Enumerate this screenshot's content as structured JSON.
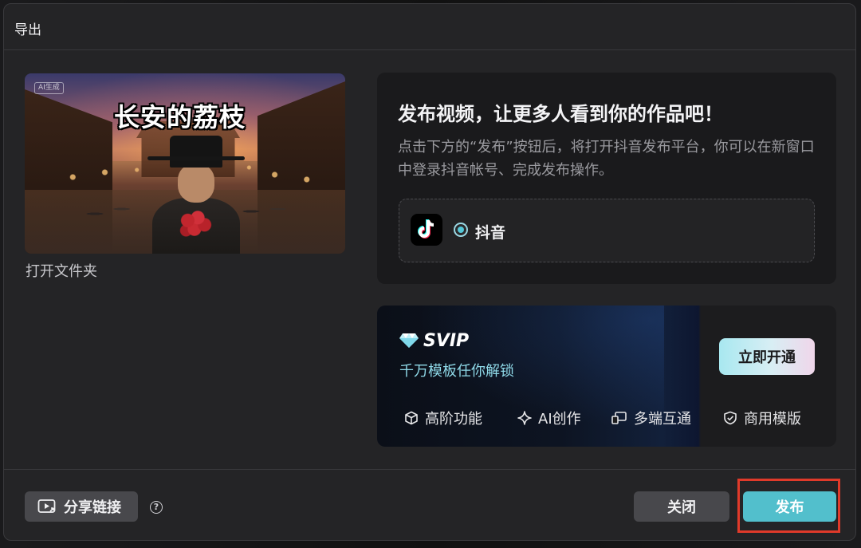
{
  "dialog": {
    "title": "导出"
  },
  "preview": {
    "video_title": "长安的荔枝",
    "ai_badge": "AI生成",
    "open_folder": "打开文件夹"
  },
  "publish": {
    "heading": "发布视频，让更多人看到你的作品吧！",
    "description": "点击下方的“发布”按钮后，将打开抖音发布平台，你可以在新窗口中登录抖音帐号、完成发布操作。",
    "platform": {
      "icon": "tiktok-icon",
      "label": "抖音",
      "selected": true
    }
  },
  "svip": {
    "badge": "SVIP",
    "subtitle": "千万模板任你解锁",
    "cta": "立即开通",
    "features": [
      {
        "icon": "cube-icon",
        "label": "高阶功能"
      },
      {
        "icon": "sparkle-icon",
        "label": "AI创作"
      },
      {
        "icon": "devices-icon",
        "label": "多端互通"
      },
      {
        "icon": "shield-check-icon",
        "label": "商用模版"
      }
    ],
    "accent": "#8fd9e8"
  },
  "footer": {
    "share_label": "分享链接",
    "help": "?",
    "close_label": "关闭",
    "publish_label": "发布"
  },
  "colors": {
    "primary_button": "#52bfcc",
    "highlight": "#e03a2a",
    "dialog_bg": "#242426"
  }
}
